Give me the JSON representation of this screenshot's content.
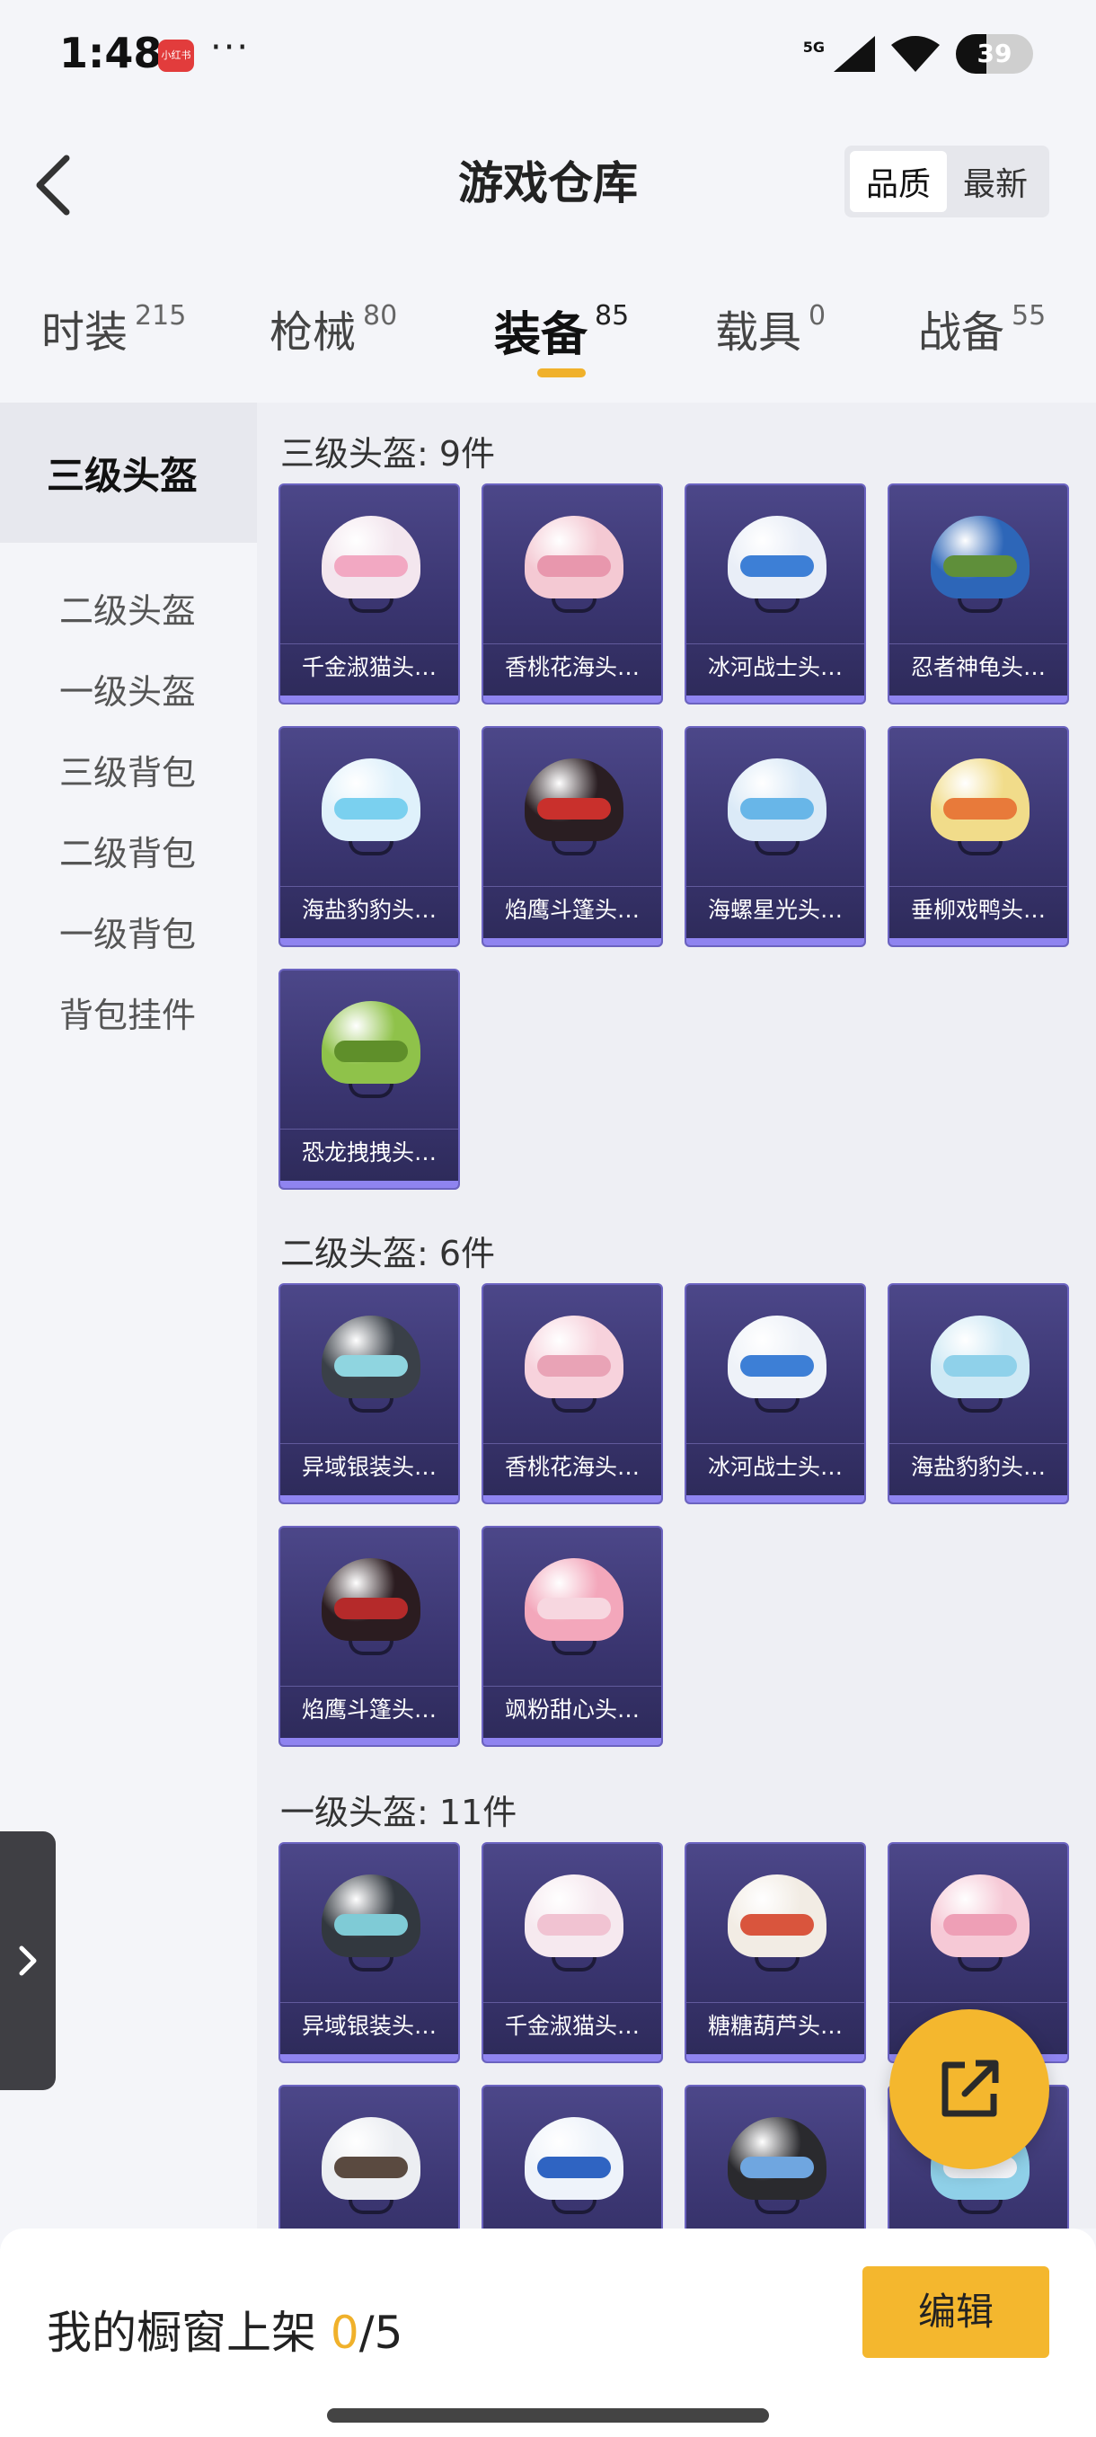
{
  "status_bar": {
    "time": "1:48",
    "app_icon_label": "小红书",
    "more": "···",
    "network": "5G",
    "battery": "39",
    "battery_level": 0.39
  },
  "header": {
    "title": "游戏仓库",
    "sort": [
      "品质",
      "最新"
    ],
    "active_sort": 0
  },
  "tabs": [
    {
      "label": "时装",
      "count": "215"
    },
    {
      "label": "枪械",
      "count": "80"
    },
    {
      "label": "装备",
      "count": "85"
    },
    {
      "label": "载具",
      "count": "0"
    },
    {
      "label": "战备",
      "count": "55"
    }
  ],
  "active_tab": 2,
  "sidebar": [
    "三级头盔",
    "二级头盔",
    "一级头盔",
    "三级背包",
    "二级背包",
    "一级背包",
    "背包挂件"
  ],
  "active_sidebar": 0,
  "sections": [
    {
      "title": "三级头盔: 9件",
      "items": [
        {
          "name": "千金淑猫头…",
          "dome": "#f3e6ee",
          "visor": "#f2a8c2"
        },
        {
          "name": "香桃花海头…",
          "dome": "#f4c9d3",
          "visor": "#e897ad"
        },
        {
          "name": "冰河战士头…",
          "dome": "#e9eef7",
          "visor": "#3d7fd6"
        },
        {
          "name": "忍者神龟头…",
          "dome": "#2d66b8",
          "visor": "#5f8f3a"
        },
        {
          "name": "海盐豹豹头…",
          "dome": "#dff1fb",
          "visor": "#7ad0ef"
        },
        {
          "name": "焰鹰斗篷头…",
          "dome": "#2a1e22",
          "visor": "#c9302c"
        },
        {
          "name": "海螺星光头…",
          "dome": "#dbeaf7",
          "visor": "#68b6e8"
        },
        {
          "name": "垂柳戏鸭头…",
          "dome": "#f1dc8a",
          "visor": "#e87a3a"
        },
        {
          "name": "恐龙拽拽头…",
          "dome": "#8fc24a",
          "visor": "#5f8f2a"
        }
      ]
    },
    {
      "title": "二级头盔: 6件",
      "items": [
        {
          "name": "异域银装头…",
          "dome": "#3a4048",
          "visor": "#8fd5e0"
        },
        {
          "name": "香桃花海头…",
          "dome": "#f7d2dc",
          "visor": "#e9a3b6"
        },
        {
          "name": "冰河战士头…",
          "dome": "#eef2f8",
          "visor": "#3d7fd6"
        },
        {
          "name": "海盐豹豹头…",
          "dome": "#cfe9f5",
          "visor": "#8fd1ea"
        },
        {
          "name": "焰鹰斗篷头…",
          "dome": "#2b1c20",
          "visor": "#b52a2a"
        },
        {
          "name": "飒粉甜心头…",
          "dome": "#f3a7bb",
          "visor": "#f7d7e0"
        }
      ]
    },
    {
      "title": "一级头盔: 11件",
      "items": [
        {
          "name": "异域银装头…",
          "dome": "#32383f",
          "visor": "#7fcbd6"
        },
        {
          "name": "千金淑猫头…",
          "dome": "#f6e9ef",
          "visor": "#f1c3d2"
        },
        {
          "name": "糖糖葫芦头…",
          "dome": "#f2ece4",
          "visor": "#d9553d"
        },
        {
          "name": "",
          "dome": "#f6c9d6",
          "visor": "#ee9fb6"
        },
        {
          "name": "",
          "dome": "#eceef2",
          "visor": "#5a4a40"
        },
        {
          "name": "",
          "dome": "#eef3fa",
          "visor": "#2f64c2"
        },
        {
          "name": "",
          "dome": "#2a2a2e",
          "visor": "#6fa6e0"
        },
        {
          "name": "",
          "dome": "#8fd0e8",
          "visor": "#f2f4f8"
        }
      ]
    }
  ],
  "bottom_bar": {
    "label": "我的橱窗上架 ",
    "count": "0",
    "total": "/5",
    "edit": "编辑"
  }
}
